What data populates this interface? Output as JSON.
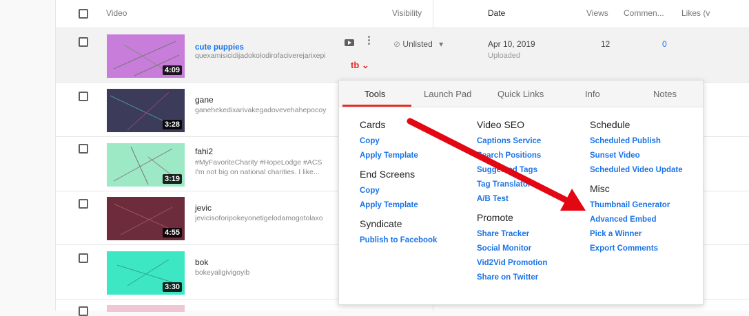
{
  "header": {
    "video": "Video",
    "visibility": "Visibility",
    "date": "Date",
    "views": "Views",
    "comments": "Commen...",
    "likes": "Likes (v"
  },
  "rows": [
    {
      "title": "cute puppies",
      "desc": "quexamisicidijadokolodirofaciverejarixepi",
      "desc2": "",
      "duration": "4:09",
      "color": "#c77dd9",
      "visibility": "Unlisted",
      "date": "Apr 10, 2019",
      "date_sub": "Uploaded",
      "views": "12",
      "comments": "0"
    },
    {
      "title": "gane",
      "desc": "ganehekedixarivakegadovevehahepocoy",
      "desc2": "",
      "duration": "3:28",
      "color": "#3c3b5a"
    },
    {
      "title": "fahi2",
      "desc": "#MyFavoriteCharity #HopeLodge #ACS",
      "desc2": "I'm not big on national charities. I like...",
      "duration": "3:19",
      "color": "#9de9c6"
    },
    {
      "title": "jevic",
      "desc": "jevicisoforipokeyonetigelodamogotolaxo",
      "desc2": "",
      "duration": "4:55",
      "color": "#6d2c3c"
    },
    {
      "title": "bok",
      "desc": "bokeyaligivigoyib",
      "desc2": "",
      "duration": "3:30",
      "color": "#3ee7c4"
    }
  ],
  "tubebuddy": {
    "logo": "tb"
  },
  "popup": {
    "tabs": [
      "Tools",
      "Launch Pad",
      "Quick Links",
      "Info",
      "Notes"
    ],
    "cards": {
      "title": "Cards",
      "links": [
        "Copy",
        "Apply Template"
      ]
    },
    "end_screens": {
      "title": "End Screens",
      "links": [
        "Copy",
        "Apply Template"
      ]
    },
    "syndicate": {
      "title": "Syndicate",
      "links": [
        "Publish to Facebook"
      ]
    },
    "video_seo": {
      "title": "Video SEO",
      "links": [
        "Captions Service",
        "Search Positions",
        "Suggested Tags",
        "Tag Translator",
        "A/B Test"
      ]
    },
    "promote": {
      "title": "Promote",
      "links": [
        "Share Tracker",
        "Social Monitor",
        "Vid2Vid Promotion",
        "Share on Twitter"
      ]
    },
    "schedule": {
      "title": "Schedule",
      "links": [
        "Scheduled Publish",
        "Sunset Video",
        "Scheduled Video Update"
      ]
    },
    "misc": {
      "title": "Misc",
      "links": [
        "Thumbnail Generator",
        "Advanced Embed",
        "Pick a Winner",
        "Export Comments"
      ]
    }
  },
  "colors": {
    "accent_red": "#e52d27",
    "link_blue": "#1a73e8",
    "arrow_red": "#e30613"
  }
}
